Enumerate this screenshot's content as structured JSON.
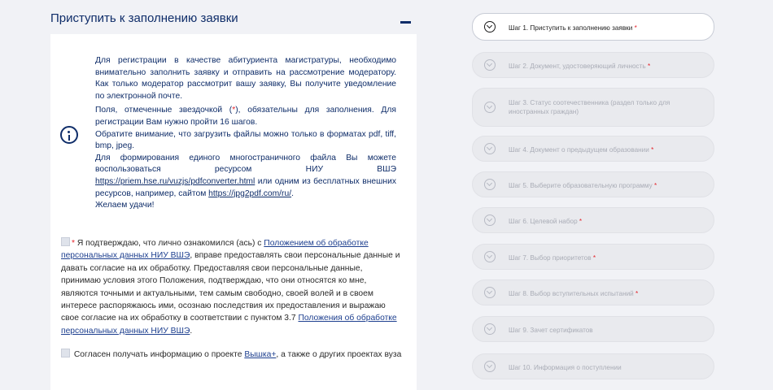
{
  "panel": {
    "title": "Приступить к заполнению заявки",
    "collapse_symbol": "minus-icon"
  },
  "info": {
    "p1": "Для регистрации в качестве абитуриента магистратуры, необходимо внимательно заполнить заявку и отправить на рассмотрение модератору. Как только модератор рассмотрит вашу заявку, Вы получите уведомление по электронной почте.",
    "p2_before": "Поля, отмеченные звездочкой (",
    "p2_star": "*",
    "p2_after": "), обязательны для заполнения. Для регистрации Вам нужно пройти 16 шагов.",
    "p3": "Обратите внимание, что загрузить файлы можно только в форматах pdf, tiff, bmp, jpeg.",
    "p4_before": "Для формирования единого многостраничного файла Вы можете воспользоваться ресурсом НИУ ВШЭ ",
    "p4_link1": "https://priem.hse.ru/vuzjs/pdfconverter.html",
    "p4_middle": " или одним из бесплатных внешних ресурсов, например, сайтом ",
    "p4_link2": "https://jpg2pdf.com/ru/",
    "p4_end": ".",
    "p5": "Желаем удачи!"
  },
  "consent": {
    "star": "*",
    "before": " Я подтверждаю, что лично ознакомился (ась) с ",
    "link1": "Положением об обработке персональных данных НИУ ВШЭ",
    "middle": ", вправе предоставлять свои персональные данные и давать согласие на их обработку. Предоставляя свои персональные данные, принимаю условия этого Положения, подтверждаю, что они относятся ко мне, являются точными и актуальными, тем самым свободно, своей волей и в своем интересе распоряжаюсь ими, осознаю последствия их предоставления и выражаю свое согласие на их обработку в соответствии с пунктом 3.7 ",
    "link2": "Положения об обработке персональных данных НИУ ВШЭ",
    "end": "."
  },
  "newsletter": {
    "before": "Согласен получать информацию о проекте ",
    "link": "Вышка+",
    "after": ", а также о других проектах вуза"
  },
  "steps": [
    {
      "label": "Шаг 1. Приступить к заполнению заявки",
      "required": "*"
    },
    {
      "label": "Шаг 2. Документ, удостоверяющий личность",
      "required": "*"
    },
    {
      "label": "Шаг 3. Статус соотечественника (раздел только для иностранных граждан)",
      "required": ""
    },
    {
      "label": "Шаг 4. Документ о предыдущем образовании",
      "required": "*"
    },
    {
      "label": "Шаг 5. Выберите образовательную программу",
      "required": "*"
    },
    {
      "label": "Шаг 6. Целевой набор",
      "required": "*"
    },
    {
      "label": "Шаг 7. Выбор приоритетов",
      "required": "*"
    },
    {
      "label": "Шаг 8. Выбор вступительных испытаний",
      "required": "*"
    },
    {
      "label": "Шаг 9. Зачет сертификатов",
      "required": ""
    },
    {
      "label": "Шаг 10. Информация о поступлении",
      "required": ""
    }
  ]
}
